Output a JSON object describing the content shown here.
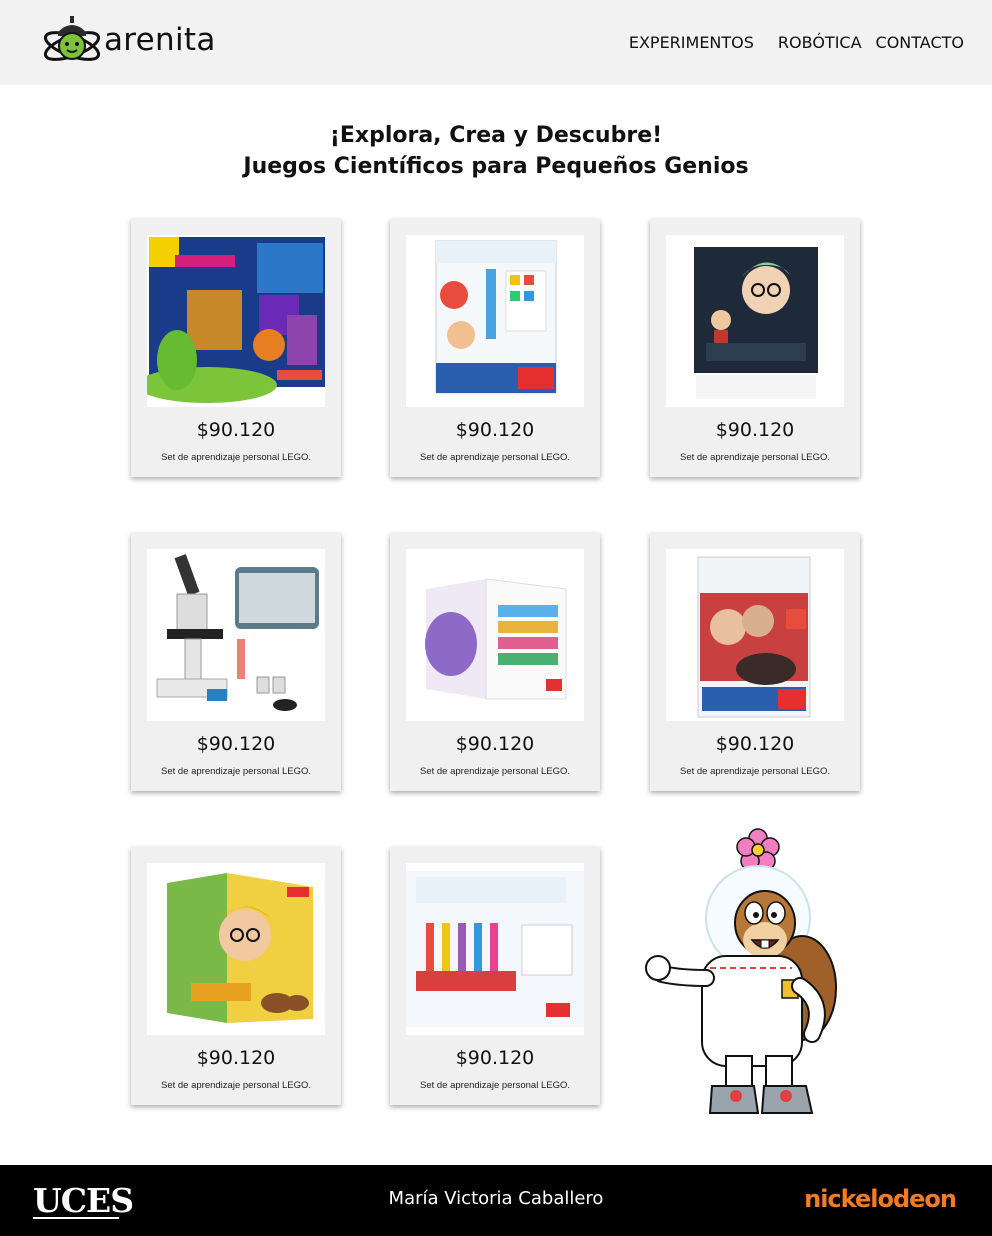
{
  "brand": {
    "name": "arenita"
  },
  "nav": {
    "items": [
      "EXPERIMENTOS",
      "ROBÓTICA",
      "CONTACTO"
    ]
  },
  "hero": {
    "line1": "¡Explora, Crea y Descubre!",
    "line2": "Juegos Científicos para Pequeños Genios"
  },
  "products": [
    {
      "price": "$90.120",
      "description": "Set de aprendizaje personal LEGO.",
      "image": "national-geographic-amazing-reactions-kit"
    },
    {
      "price": "$90.120",
      "description": "Set de aprendizaje personal LEGO.",
      "image": "juego-de-ciencias-la-ciencia-del-agua"
    },
    {
      "price": "$90.120",
      "description": "Set de aprendizaje personal LEGO.",
      "image": "dr-eureka-board-game"
    },
    {
      "price": "$90.120",
      "description": "Set de aprendizaje personal LEGO.",
      "image": "microscope-kit"
    },
    {
      "price": "$90.120",
      "description": "Set de aprendizaje personal LEGO.",
      "image": "experimentando-box"
    },
    {
      "price": "$90.120",
      "description": "Set de aprendizaje personal LEGO.",
      "image": "juego-de-ciencias-volcan"
    },
    {
      "price": "$90.120",
      "description": "Set de aprendizaje personal LEGO.",
      "image": "botanica-kit"
    },
    {
      "price": "$90.120",
      "description": "Set de aprendizaje personal LEGO.",
      "image": "mis-primeros-experimentos"
    }
  ],
  "footer": {
    "left_logo": "UCES",
    "author": "María Victoria Caballero",
    "right_logo": "nickelodeon"
  },
  "colors": {
    "header_bg": "#f2f2f2",
    "footer_bg": "#000000",
    "nick_orange": "#f57b20",
    "card_bg": "#f0f0f0"
  }
}
